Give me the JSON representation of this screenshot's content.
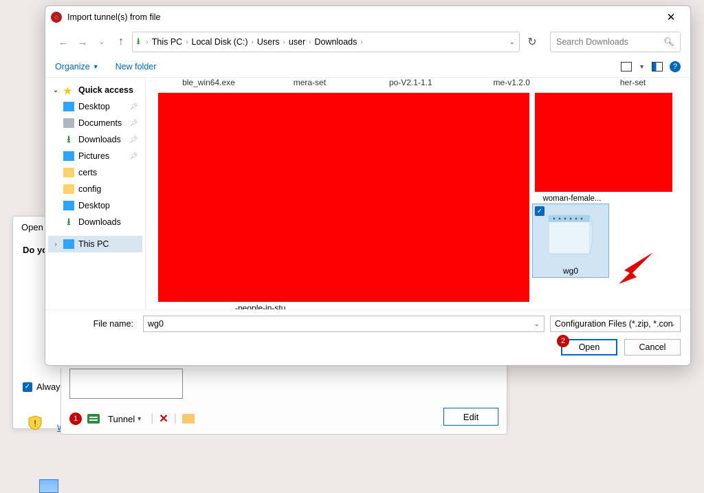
{
  "bg_dialog": {
    "title_fragment": "Open Fi",
    "question_fragment": "Do yo",
    "always_label": "Alway",
    "risk_link": "What s the risk?"
  },
  "tunnel_bar": {
    "badge1": "1",
    "tunnel_label": "Tunnel",
    "delete_glyph": "✕",
    "edit_label": "Edit"
  },
  "dialog": {
    "title": "Import tunnel(s) from file",
    "close_glyph": "✕",
    "nav": {
      "back": "←",
      "fwd": "→",
      "up": "↑",
      "crumbs": [
        "This PC",
        "Local Disk (C:)",
        "Users",
        "user",
        "Downloads"
      ],
      "refresh": "↻",
      "search_placeholder": "Search Downloads"
    },
    "toolbar": {
      "organize": "Organize",
      "new_folder": "New folder",
      "help": "?"
    },
    "sidebar": {
      "quick": "Quick access",
      "items": [
        {
          "label": "Desktop",
          "pin": true
        },
        {
          "label": "Documents",
          "pin": true
        },
        {
          "label": "Downloads",
          "pin": true
        },
        {
          "label": "Pictures",
          "pin": true
        },
        {
          "label": "certs",
          "pin": false
        },
        {
          "label": "config",
          "pin": false
        },
        {
          "label": "Desktop",
          "pin": false
        },
        {
          "label": "Downloads",
          "pin": false
        }
      ],
      "this_pc": "This PC"
    },
    "content": {
      "top_row": [
        "ble_win64.exe",
        "mera-set",
        "po-V2.1-1.1",
        "me-v1.2.0",
        "her-set"
      ],
      "mid_label": "-people-in-stu...",
      "woman_label": "woman-female...",
      "selected_label": "wg0"
    },
    "footer": {
      "filename_label": "File name:",
      "filename_value": "wg0",
      "filetype_value": "Configuration Files (*.zip, *.con",
      "open": "Open",
      "cancel": "Cancel",
      "badge2": "2"
    }
  }
}
